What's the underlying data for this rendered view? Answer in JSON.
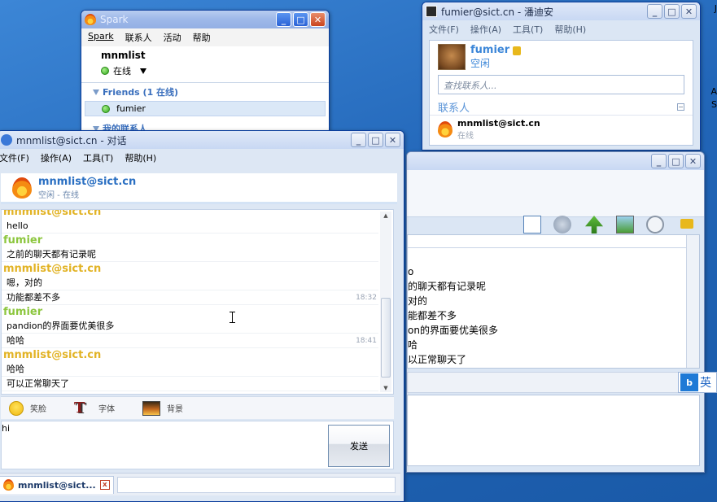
{
  "desktop": {
    "edge_top": "J",
    "edge_mid": "A",
    "edge_mid2": "S"
  },
  "spark": {
    "title": "Spark",
    "menu": [
      "Spark",
      "联系人",
      "活动",
      "帮助"
    ],
    "user": "mnmlist",
    "status": "在线",
    "group_friends": "Friends (1 在线)",
    "friend": "fumier",
    "group_mine": "我的联系人"
  },
  "pandion": {
    "title": "fumier@sict.cn - 潘迪安",
    "menu": [
      "文件(F)",
      "操作(A)",
      "工具(T)",
      "帮助(H)"
    ],
    "name": "fumier",
    "status": "空闲",
    "search_placeholder": "查找联系人...",
    "section": "联系人",
    "contact_name": "mnmlist@sict.cn",
    "contact_status": "在线"
  },
  "pandion_chat": {
    "lines": [
      "o",
      "的聊天都有记录呢",
      "对的",
      "能都差不多",
      "on的界面要优美很多",
      "",
      "哈",
      "以正常聊天了"
    ]
  },
  "ime": {
    "label": "英"
  },
  "chat": {
    "title": "mnmlist@sict.cn - 对话",
    "menu": [
      "文件(F)",
      "操作(A)",
      "工具(T)",
      "帮助(H)"
    ],
    "contact": "mnmlist@sict.cn",
    "contact_status": "空闲 - 在线",
    "messages": [
      {
        "sender": "mnmlist@sict.cn",
        "who": "me",
        "lines": [
          {
            "text": "hello",
            "time": ""
          }
        ]
      },
      {
        "sender": "fumier",
        "who": "them",
        "lines": [
          {
            "text": "之前的聊天都有记录呢",
            "time": ""
          }
        ]
      },
      {
        "sender": "mnmlist@sict.cn",
        "who": "me",
        "lines": [
          {
            "text": "嗯，对的",
            "time": ""
          },
          {
            "text": "功能都差不多",
            "time": "18:32"
          }
        ]
      },
      {
        "sender": "fumier",
        "who": "them",
        "lines": [
          {
            "text": "pandion的界面要优美很多",
            "time": ""
          },
          {
            "text": "哈哈",
            "time": "18:41"
          }
        ]
      },
      {
        "sender": "mnmlist@sict.cn",
        "who": "me",
        "lines": [
          {
            "text": "哈哈",
            "time": ""
          },
          {
            "text": "可以正常聊天了",
            "time": ""
          }
        ]
      }
    ],
    "toolbar": {
      "emoticon": "笑脸",
      "font": "字体",
      "background": "背景"
    },
    "compose_text": "hi",
    "send_label": "发送",
    "tab_label": "mnmlist@sict...",
    "tab_close": "x"
  }
}
